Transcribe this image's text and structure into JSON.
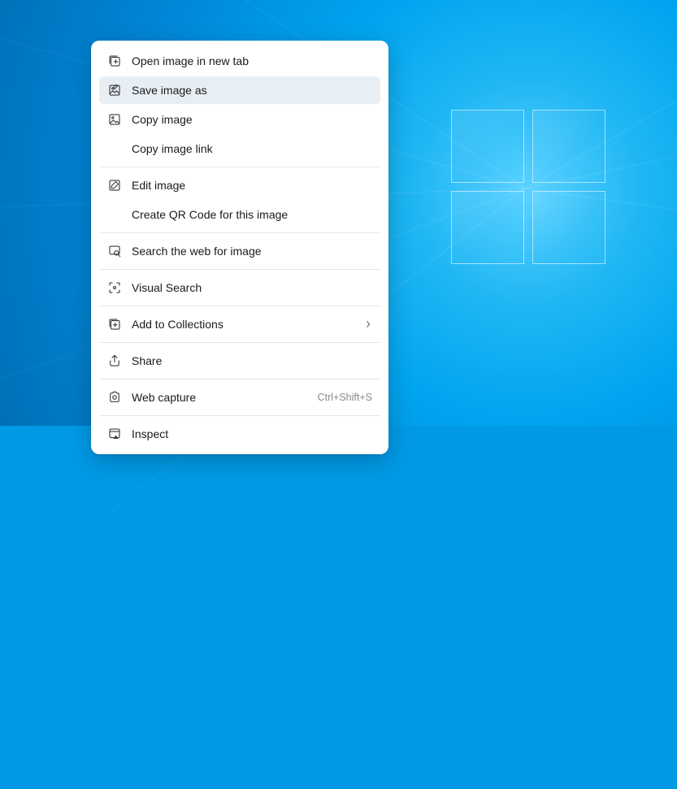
{
  "contextMenu": {
    "items": [
      {
        "label": "Open image in new tab"
      },
      {
        "label": "Save image as"
      },
      {
        "label": "Copy image"
      },
      {
        "label": "Copy image link"
      },
      {
        "label": "Edit image"
      },
      {
        "label": "Create QR Code for this image"
      },
      {
        "label": "Search the web for image"
      },
      {
        "label": "Visual Search"
      },
      {
        "label": "Add to Collections"
      },
      {
        "label": "Share"
      },
      {
        "label": "Web capture",
        "shortcut": "Ctrl+Shift+S"
      },
      {
        "label": "Inspect"
      }
    ],
    "hoveredIndex": 1
  }
}
